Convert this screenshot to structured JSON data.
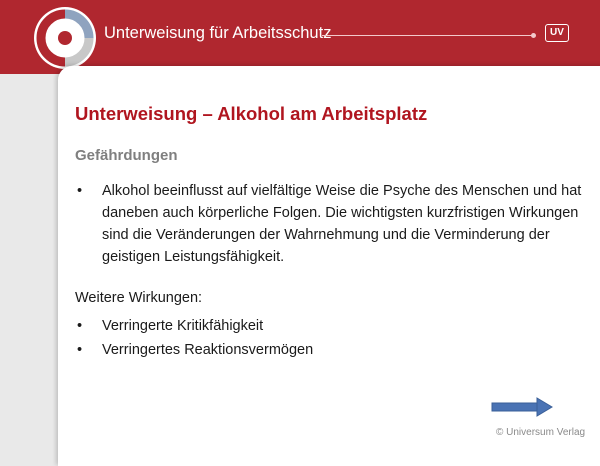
{
  "header": {
    "title": "Unterweisung für Arbeitsschutz",
    "badge": "UV",
    "color": "#b0272f"
  },
  "slide": {
    "title": "Unterweisung – Alkohol am Arbeitsplatz",
    "section_heading": "Gefährdungen",
    "bullet_symbol": "•",
    "main_bullets": [
      "Alkohol beeinflusst auf vielfältige Weise die Psyche des Menschen und hat daneben auch körperliche Folgen. Die wichtigsten kurzfristigen Wirkungen sind die Veränderungen der Wahrnehmung und die Verminderung der geistigen Leistungsfähigkeit."
    ],
    "more_heading": "Weitere Wirkungen:",
    "more_bullets": [
      "Verringerte Kritikfähigkeit",
      "Verringertes Reaktionsvermögen"
    ]
  },
  "footer": {
    "next_icon": "arrow-right-icon",
    "copyright": "© Universum Verlag"
  }
}
